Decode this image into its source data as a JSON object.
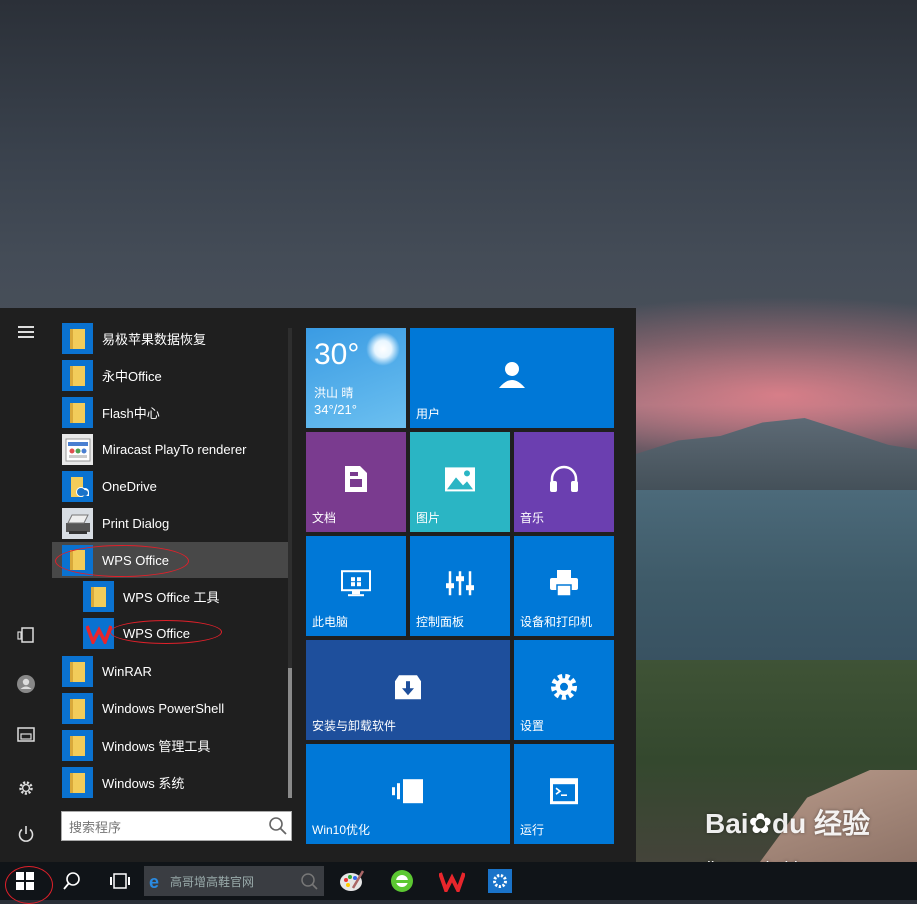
{
  "watermark": {
    "text": "Bai du 经验",
    "url": "jingyan.baidu.com"
  },
  "rail": {
    "items": [
      "hamburger-icon",
      "tablet-icon",
      "user-icon",
      "explorer-icon",
      "gear-icon",
      "power-icon"
    ]
  },
  "app_list": {
    "items": [
      {
        "label": "易极苹果数据恢复",
        "icon": "folder-icon"
      },
      {
        "label": "永中Office",
        "icon": "folder-icon"
      },
      {
        "label": "Flash中心",
        "icon": "folder-icon"
      },
      {
        "label": "Miracast PlayTo renderer",
        "icon": "miracast-icon"
      },
      {
        "label": "OneDrive",
        "icon": "onedrive-icon"
      },
      {
        "label": "Print Dialog",
        "icon": "printer-icon"
      },
      {
        "label": "WPS Office",
        "icon": "folder-icon",
        "selected": true
      },
      {
        "label": "WPS Office 工具",
        "icon": "folder-icon",
        "sub": true
      },
      {
        "label": "WPS Office",
        "icon": "wps-icon",
        "sub": true
      },
      {
        "label": "WinRAR",
        "icon": "folder-icon"
      },
      {
        "label": "Windows PowerShell",
        "icon": "folder-icon"
      },
      {
        "label": "Windows 管理工具",
        "icon": "folder-icon"
      },
      {
        "label": "Windows 系统",
        "icon": "folder-icon"
      }
    ]
  },
  "search": {
    "placeholder": "搜索程序"
  },
  "tiles": {
    "weather": {
      "temp": "30°",
      "city": "洪山  晴",
      "range": "34°/21°"
    },
    "user": "用户",
    "docs": "文档",
    "pictures": "图片",
    "music": "音乐",
    "this_pc": "此电脑",
    "control_panel": "控制面板",
    "devices_printers": "设备和打印机",
    "install_uninstall": "安装与卸载软件",
    "settings": "设置",
    "win10_optimize": "Win10优化",
    "run": "运行"
  },
  "taskbar": {
    "search_text": "高哥增高鞋官网",
    "apps": [
      "start-icon",
      "search-icon",
      "task-view-icon",
      "ie-icon",
      "paint-icon",
      "browser-icon",
      "wps-icon",
      "settings-icon"
    ]
  },
  "colors": {
    "tile_blue": "#0078d7",
    "tile_purple": "#7a3b8f",
    "tile_teal": "#2ab5c4",
    "tile_violet": "#6b3fb0",
    "tile_navy": "#1e4f9c",
    "annotation_red": "#e0202a"
  }
}
